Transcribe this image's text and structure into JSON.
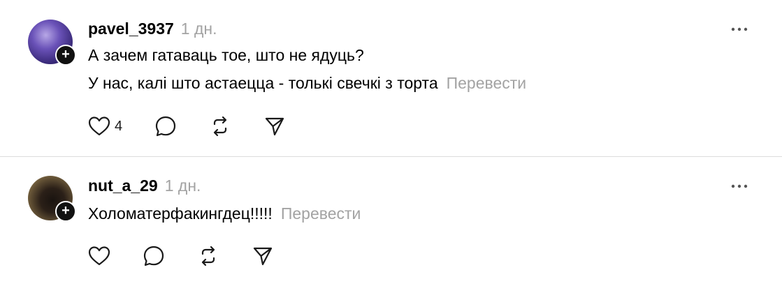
{
  "posts": [
    {
      "username": "pavel_3937",
      "timestamp": "1 дн.",
      "lines": [
        "А зачем гатаваць тое, што не ядуць?",
        "У нас, калі што астаецца - толькі свечкі з торта"
      ],
      "translate_label": "Перевести",
      "like_count": "4"
    },
    {
      "username": "nut_a_29",
      "timestamp": "1 дн.",
      "lines": [
        "Холоматерфакингдец!!!!!"
      ],
      "translate_label": "Перевести",
      "like_count": ""
    }
  ],
  "icons": {
    "like": "heart-icon",
    "comment": "speech-bubble-icon",
    "repost": "repost-icon",
    "share": "send-icon",
    "more": "more-horizontal-icon",
    "follow": "plus-icon"
  },
  "colors": {
    "muted_text": "#a3a3a3",
    "primary_text": "#000000",
    "divider": "#dcdcdc"
  }
}
